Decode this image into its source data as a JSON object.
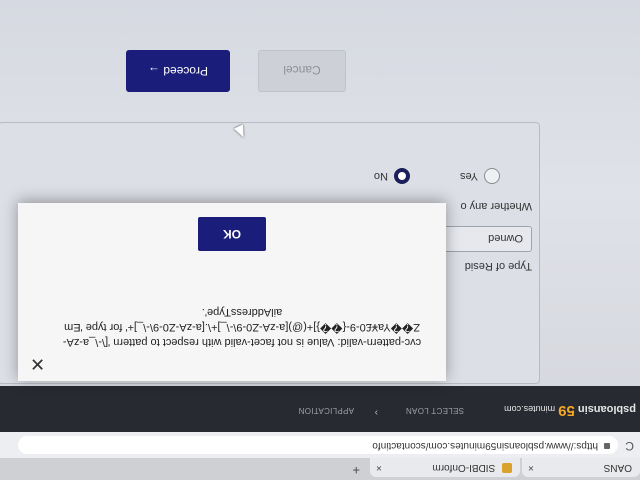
{
  "browser": {
    "tabs": [
      {
        "label": "OANS",
        "close": "×"
      },
      {
        "label": "SIDBI-Onform",
        "close": "×"
      }
    ],
    "new_tab": "+",
    "url": "https://www.psbloansin59minutes.com/scontactinfo"
  },
  "site": {
    "logo_prefix": "psbloansin",
    "logo_number": "59",
    "logo_suffix": "minutes.com",
    "nav": [
      "SELECT LOAN",
      "APPLICATION"
    ]
  },
  "form": {
    "type_of_residence_label": "Type of Resid",
    "residence_value": "Owned",
    "whether_label": "Whether any o",
    "radio_yes": "Yes",
    "radio_no": "No",
    "radio_selected": "No",
    "cancel_label": "Cancel",
    "proceed_label": "Proceed →"
  },
  "dialog": {
    "message": "cvc-pattern-valid: Value is not facet-valid with respect to pattern '[\\-\\_a-zA-Z��Ya¥£0-9-{��}]+(@)[a-zA-Z0-9\\-\\_]+\\.[a-zA-Z0-9\\-\\_]+' for type 'EmailAddressType'.",
    "ok_label": "OK",
    "close_label": "✕"
  }
}
